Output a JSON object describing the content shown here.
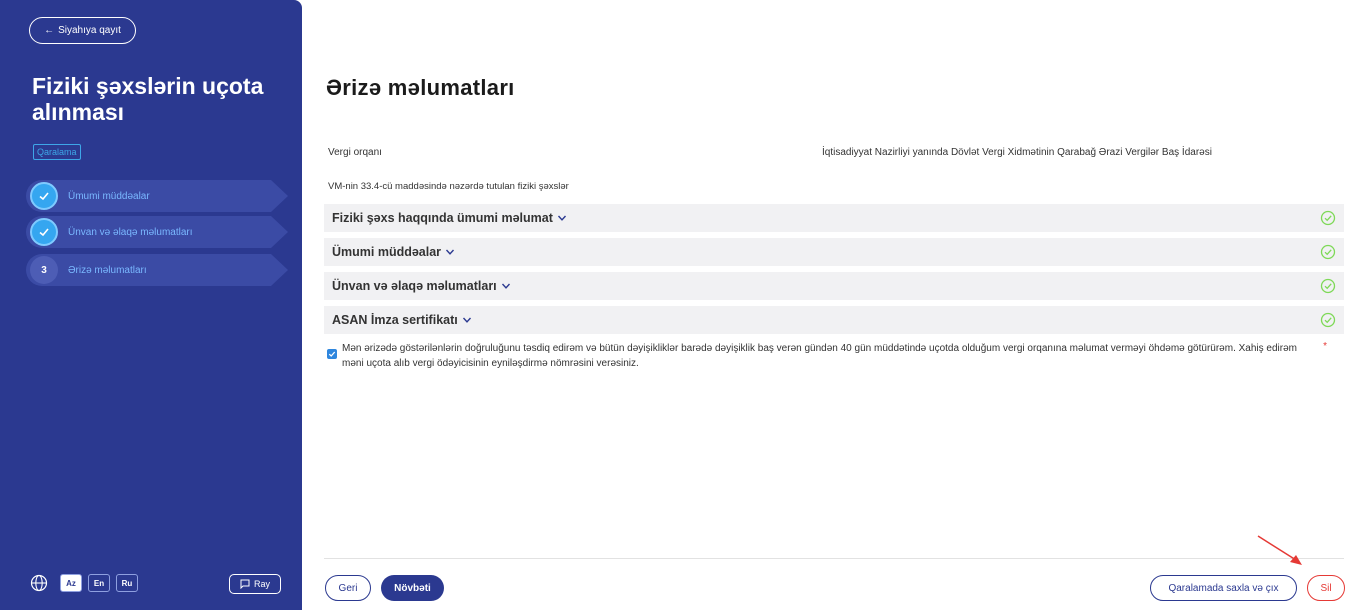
{
  "sidebar": {
    "back_label": "Siyahıya qayıt",
    "title": "Fiziki şəxslərin uçota alınması",
    "badge": "Qaralama",
    "steps": [
      {
        "label": "Ümumi müddəalar",
        "state": "done"
      },
      {
        "label": "Ünvan və əlaqə məlumatları",
        "state": "done"
      },
      {
        "number": "3",
        "label": "Ərizə məlumatları",
        "state": "current"
      }
    ],
    "languages": [
      "Az",
      "En",
      "Ru"
    ],
    "active_language": "Az",
    "ray_label": "Ray"
  },
  "main": {
    "title": "Ərizə məlumatları",
    "tax_office_label": "Vergi orqanı",
    "tax_office_value": "İqtisadiyyat Nazirliyi yanında Dövlət Vergi Xidmətinin Qarabağ Ərazi Vergilər Baş İdarəsi",
    "subtitle": "VM-nin 33.4-cü maddəsində nəzərdə tutulan fiziki şəxslər",
    "sections": [
      {
        "title": "Fiziki şəxs haqqında ümumi məlumat"
      },
      {
        "title": "Ümumi müddəalar"
      },
      {
        "title": "Ünvan və əlaqə məlumatları"
      },
      {
        "title": "ASAN İmza sertifikatı"
      }
    ],
    "consent_text": "Mən ərizədə göstərilənlərin doğruluğunu təsdiq edirəm və bütün dəyişikliklər barədə dəyişiklik baş verən gündən 40 gün müddətində uçotda olduğum vergi orqanına məlumat verməyi öhdəmə götürürəm. Xahiş edirəm məni uçota alıb vergi ödəyicisinin eyniləşdirmə nömrəsini verəsiniz.",
    "consent_checked": true,
    "required_mark": "*"
  },
  "footer": {
    "back_label": "Geri",
    "next_label": "Növbəti",
    "save_exit_label": "Qaralamada saxla və çıx",
    "delete_label": "Sil"
  },
  "colors": {
    "sidebar_bg": "#2b3990",
    "accent": "#35a6f0",
    "success": "#7ed957",
    "danger": "#e53935"
  }
}
